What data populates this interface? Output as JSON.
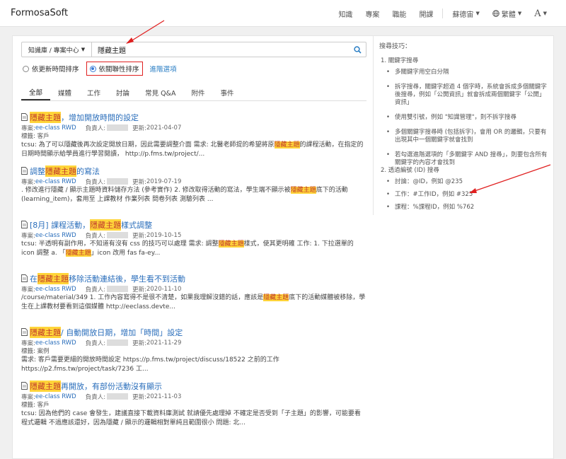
{
  "app": {
    "brand": "FormosaSoft"
  },
  "nav": {
    "knowledge": "知識",
    "projects": "專案",
    "jobs": "職能",
    "courses": "開課",
    "user": "蘇德宙",
    "lang": "繁體",
    "font": "A"
  },
  "search": {
    "scope": "知識庫 / 專案中心",
    "query_prefix": "隱藏主題"
  },
  "sort": {
    "by_time": "依更新時間排序",
    "by_relevance": "依關聯性排序",
    "advanced": "進階選項"
  },
  "tabs": [
    "全部",
    "媒體",
    "工作",
    "討論",
    "常見 Q&A",
    "附件",
    "事件"
  ],
  "labels": {
    "project": "專案:",
    "owner": "負責人:",
    "updated": "更新:"
  },
  "results": [
    {
      "title_hl": "隱藏主題",
      "title_rest": "，增加開放時間的設定",
      "project": "ee-class RWD",
      "updated": "2021-04-07",
      "tags": "標籤: 客戶",
      "snip_pre": "tcsu: 為了可以隱藏後再次設定開放日期，因此需要調整介面 需求: 北醫老師提的希望將原",
      "snip_hl": "隱藏主題",
      "snip_post": "的課程活動，在指定的日期時間顯示給學員進行學習閱讀， http://p.fms.tw/project/..."
    },
    {
      "title_pre": "調整",
      "title_hl": "隱藏主題",
      "title_rest": "的寫法",
      "project": "ee-class RWD",
      "updated": "2019-07-19",
      "snip_pre": ". 修改進行隱藏 / 顯示主題時資料儲存方法 (參考實作) 2. 修改取得活動的寫法，學生端不顯示被",
      "snip_hl": "隱藏主題",
      "snip_post": "底下的活動(learning_item)，套用至 上課教材 作業列表 問卷列表 測驗列表 ..."
    },
    {
      "title_pre": "[8月] 課程活動，",
      "title_hl": "隱藏主題",
      "title_rest": "樣式調整",
      "project": "ee-class RWD",
      "updated": "2019-10-15",
      "snip_pre": "tcsu: 半透明有副作用，不知道有沒有 css 的技巧可以處理 需求: 調整",
      "snip_hl": "隱藏主題",
      "snip_post": "樣式，使其更明確 工作: 1. 下拉選單的 icon 調整 a. 「",
      "snip_hl2": "隱藏主題",
      "snip_post2": "」icon 改用 fas fa-ey..."
    },
    {
      "title_pre": "在",
      "title_hl": "隱藏主題",
      "title_rest": "移除活動連結後，學生看不到活動",
      "project": "ee-class RWD",
      "updated": "2020-11-10",
      "snip_pre": "/course/material/349 1. 工作內容寫得不是很不清楚，如果我理解沒錯的話，應該是",
      "snip_hl": "隱藏主題",
      "snip_post": "底下的活動媒體被移除，學生在上課教材要看到這個媒體 http://eeclass.devte..."
    },
    {
      "title_hl": "隱藏主題",
      "title_rest": " / 自動開放日期，增加「時間」設定",
      "project": "ee-class RWD",
      "updated": "2021-11-29",
      "tags": "標籤: 案例",
      "snip_pre": "需求: 客戶需要更細的開放時間設定 https://p.fms.tw/project/discuss/18522 之前的工作 https://p2.fms.tw/project/task/7236 工...",
      "snip_hl": "",
      "snip_post": ""
    },
    {
      "title_hl": "隱藏主題",
      "title_rest": "再開放，有部份活動沒有顯示",
      "project": "ee-class RWD",
      "updated": "2021-11-03",
      "tags": "標籤: 客戶",
      "snip_pre": "tcsu: 因為他們的 case 會發生，建議直接下載資料庫測試 就請優先處理掉 不確定是否受到「子主題」的影響，可能要看程式邏輯 不過應該還好，因為隱藏 / 顯示的邏輯相對單純且範圍很小 問題: 北...",
      "snip_hl": "",
      "snip_post": ""
    }
  ],
  "tips": {
    "heading": "搜尋技巧：",
    "sec1": "1. 關鍵字搜尋",
    "items1": [
      "多關鍵字用空白分隔",
      "拆字搜尋，關鍵字超過 4 個字時，系統會拆成多個關鍵字後搜尋，例如「公開資訊」就會拆成兩個關鍵字「公開」資訊」",
      "使用雙引號，例如 \"知識管理\"，則不拆字搜尋",
      "多個關鍵字搜尋時 (包括拆字)，會用 OR 的邏輯，只要有出現其中一個關鍵字就會找到",
      "若勾選進階選項的「多關鍵字 AND 搜尋」，則要包含所有關鍵字的內容才會找到"
    ],
    "sec2": "2. 透過編號 (ID) 搜尋",
    "items2": [
      "討論：@ID，例如 @235",
      "工作：#工作ID，例如 #325",
      "課程：%課程ID，例如 %762"
    ]
  },
  "colors": {
    "link": "#2a6ebb",
    "highlight": "#ffd53a",
    "arrow": "#e02020"
  }
}
